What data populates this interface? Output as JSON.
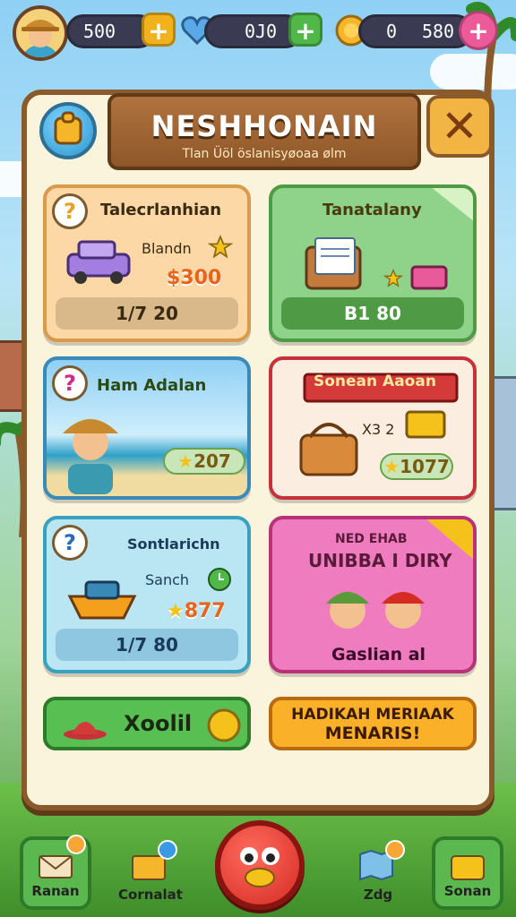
{
  "topbar": {
    "res1_value": "500",
    "res2_value": "0J0",
    "res3_value_a": "0",
    "res3_value_b": "580",
    "plus_symbol": "+",
    "icons": [
      "avatar",
      "coin-icon",
      "heart-icon",
      "gem-icon"
    ]
  },
  "panel": {
    "title": "NESHHONAIN",
    "subtitle": "Tlan Üöl öslanisyøoaa ølm",
    "close_symbol": "✕"
  },
  "cards": [
    {
      "help": "?",
      "title": "Talecrlanhian",
      "label": "Blandn",
      "price": "$300",
      "bar": "1/7 20"
    },
    {
      "title": "Tanatalany",
      "bar": "B1 80"
    },
    {
      "help": "?",
      "title": "Ham Adalan",
      "price": "207"
    },
    {
      "title": "Sonean Aaoan",
      "label": "X3 2",
      "price": "1077"
    },
    {
      "help": "?",
      "title": "Sontlarichn",
      "label": "Sanch",
      "price": "877",
      "bar": "1/7 80"
    },
    {
      "title_top": "NED EHAB",
      "title": "UNIBBA I DIRY",
      "label": "Gaslian al"
    }
  ],
  "buttons": {
    "left_label": "Xoolil",
    "right_line1": "HADIKAH MERIAAK",
    "right_line2": "MENARIS!"
  },
  "nav": [
    {
      "label": "Ranan"
    },
    {
      "label": "Cornalat"
    },
    {
      "label": ""
    },
    {
      "label": "Zdg"
    },
    {
      "label": "Sonan"
    }
  ],
  "colors": {
    "panel_bg": "#fbf4dd",
    "wood": "#8b5a2b",
    "accent_orange": "#f7a534",
    "accent_green": "#4fb848"
  }
}
